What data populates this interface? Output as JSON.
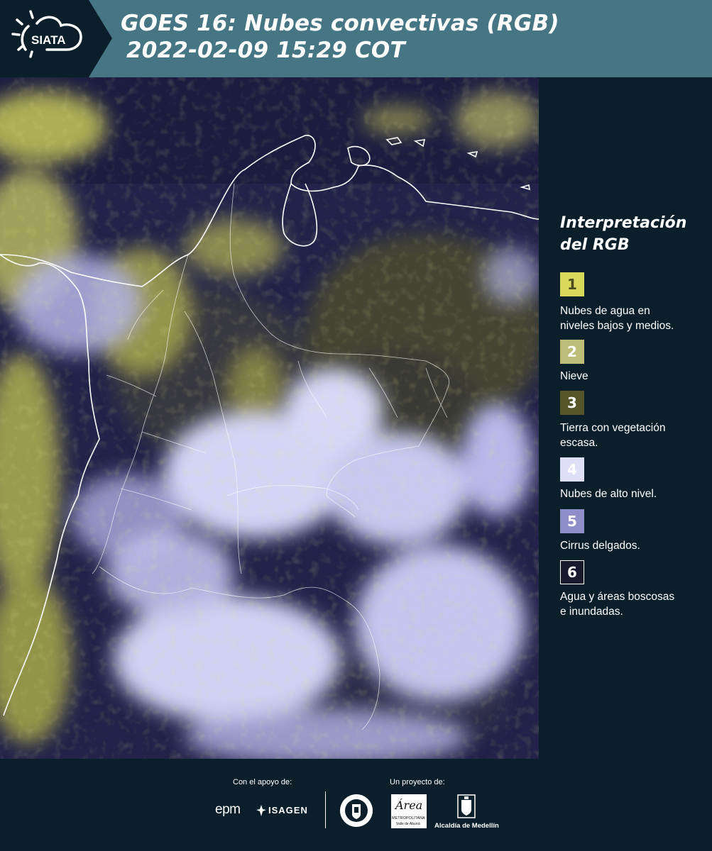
{
  "header": {
    "logo_text": "SIATA",
    "title_line1": "GOES 16: Nubes convectivas (RGB)",
    "title_line2": "2022-02-09 15:29 COT"
  },
  "legend": {
    "title_line1": "Interpretación",
    "title_line2": "del RGB",
    "items": [
      {
        "number": "1",
        "line1": "Nubes de agua en",
        "line2": "niveles bajos y medios.",
        "color": "#d8d85a",
        "text_color": "#4b4b20"
      },
      {
        "number": "2",
        "line1": "Nieve",
        "line2": "",
        "color": "#bdbd78",
        "text_color": "#ffffff"
      },
      {
        "number": "3",
        "line1": "Tierra con vegetación",
        "line2": "escasa.",
        "color": "#55552a",
        "text_color": "#ffffff"
      },
      {
        "number": "4",
        "line1": "Nubes de alto nivel.",
        "line2": "",
        "color": "#dedef6",
        "text_color": "#ffffff"
      },
      {
        "number": "5",
        "line1": "Cirrus delgados.",
        "line2": "",
        "color": "#8e8ec8",
        "text_color": "#ffffff"
      },
      {
        "number": "6",
        "line1": "Agua y áreas boscosas",
        "line2": "e inundadas.",
        "color": "#1a1a2e",
        "text_color": "#ffffff"
      }
    ]
  },
  "footer": {
    "support_label": "Con el apoyo de:",
    "project_label": "Un proyecto de:",
    "sponsor_1": "epm",
    "sponsor_2": "ISAGEN",
    "area_logo_script": "Área",
    "area_logo_line1": "METROPOLITANA",
    "area_logo_line2": "Valle de Aburrá",
    "alcaldia_label": "Alcaldía de Medellín"
  },
  "colors": {
    "header_bg": "#467583",
    "logo_band": "#0b1f2b",
    "panel_bg": "#0b1f2b",
    "map_background": "#23234a",
    "high_cloud": "#d6d6f4",
    "low_cloud": "#d8d860"
  }
}
